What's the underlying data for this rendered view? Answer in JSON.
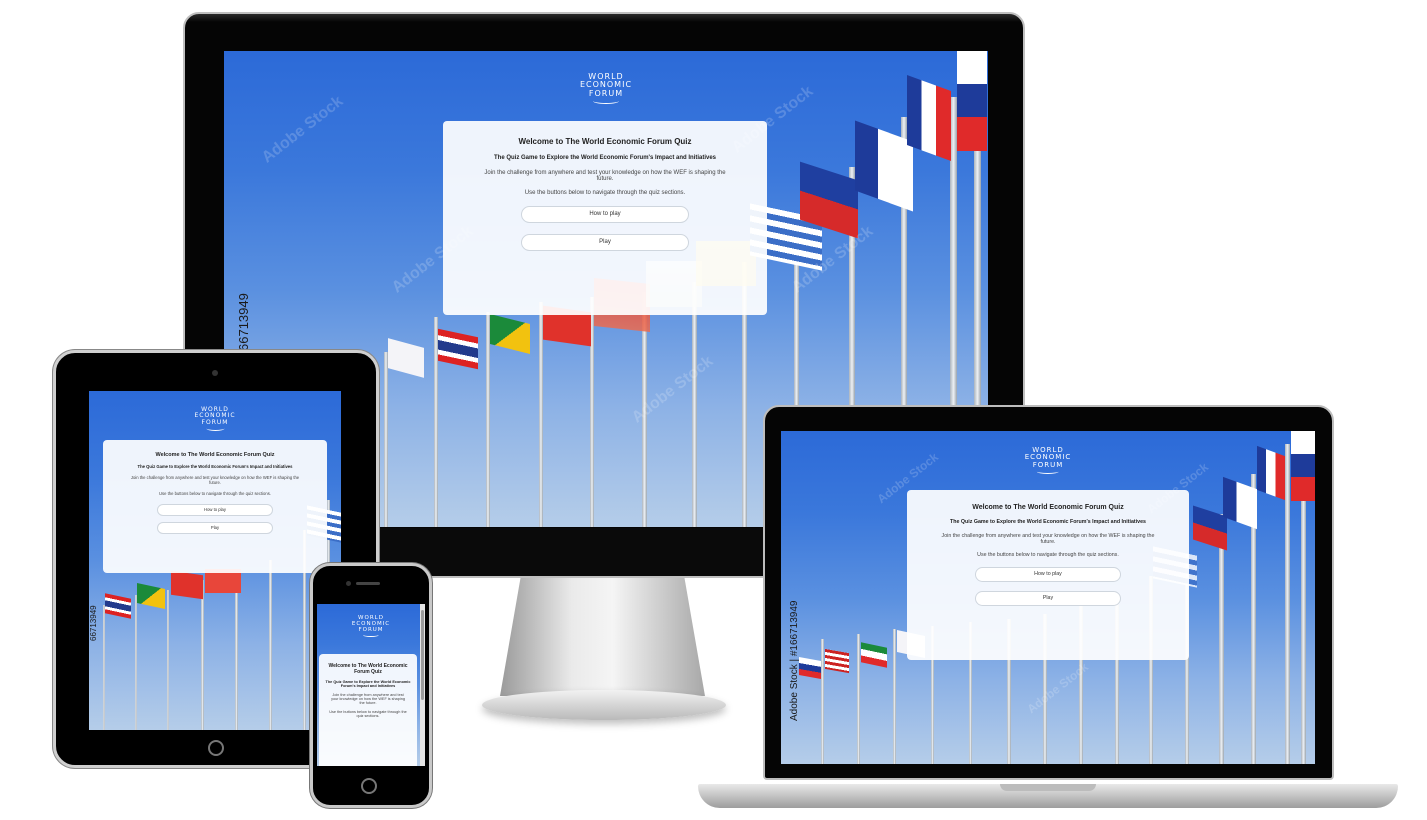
{
  "site": {
    "logo": {
      "line1": "WORLD",
      "line2": "ECONOMIC",
      "line3": "FORUM"
    },
    "card": {
      "title": "Welcome to The World Economic Forum Quiz",
      "subtitle": "The Quiz Game to Explore the World Economic Forum's Impact and Initiatives",
      "intro": "Join the challenge from anywhere and test your knowledge on how the WEF is shaping the future.",
      "nav_hint": "Use the buttons below to navigate through the quiz sections.",
      "how_to_play_label": "How to play",
      "play_label": "Play"
    },
    "watermark_text": "Adobe Stock",
    "stock_id_short": "66713949",
    "stock_id_full": "Adobe Stock | #166713949"
  },
  "colors": {
    "sky_top": "#2c6ad8",
    "sky_bottom": "#b5cde9",
    "card_bg": "#ffffff"
  },
  "devices": [
    "desktop-monitor",
    "tablet",
    "smartphone",
    "laptop"
  ]
}
